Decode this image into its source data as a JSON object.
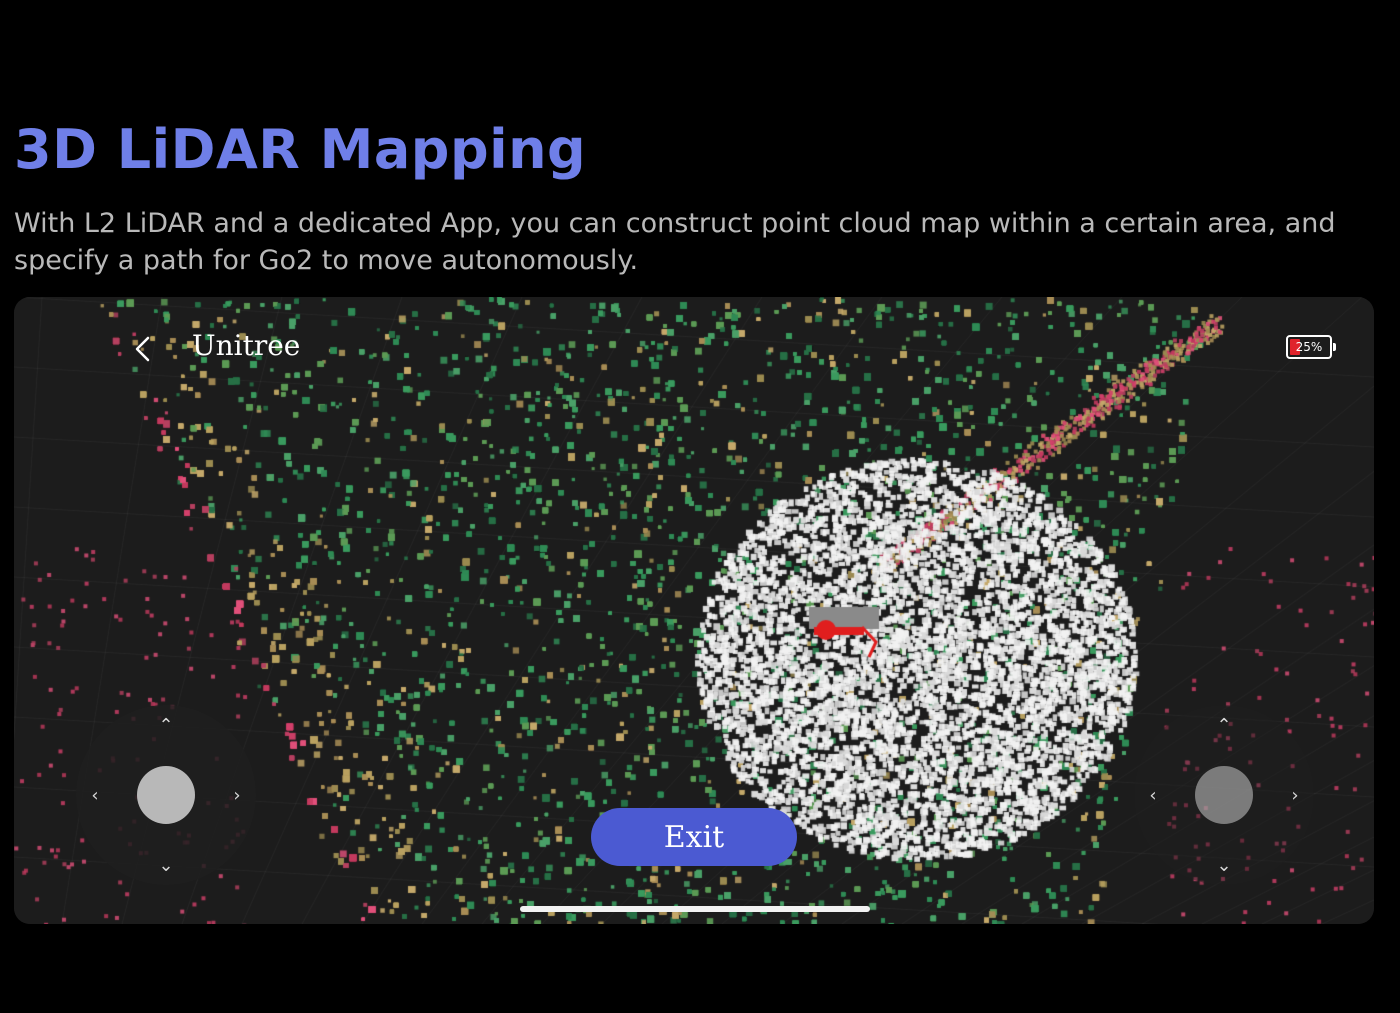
{
  "heading": {
    "title": "3D LiDAR Mapping",
    "description": "With L2 LiDAR and a dedicated App, you can construct point cloud map within a certain area, and specify a path for Go2 to move autonomously."
  },
  "app": {
    "name": "Unitree",
    "back_icon": "chevron-left-icon",
    "battery": {
      "label": "25%",
      "level": 0.25,
      "fill_color": "#e0232b"
    },
    "exit_label": "Exit",
    "joystick_arrows": {
      "up": "⌃",
      "down": "⌄",
      "left": "‹",
      "right": "›"
    }
  },
  "colors": {
    "title": "#6f7fe8",
    "exit_button": "#4b5ad2",
    "point_green": "#2f8a55",
    "point_tan": "#b8a060",
    "point_pink": "#d2406a",
    "point_white": "#f2f2f2"
  }
}
